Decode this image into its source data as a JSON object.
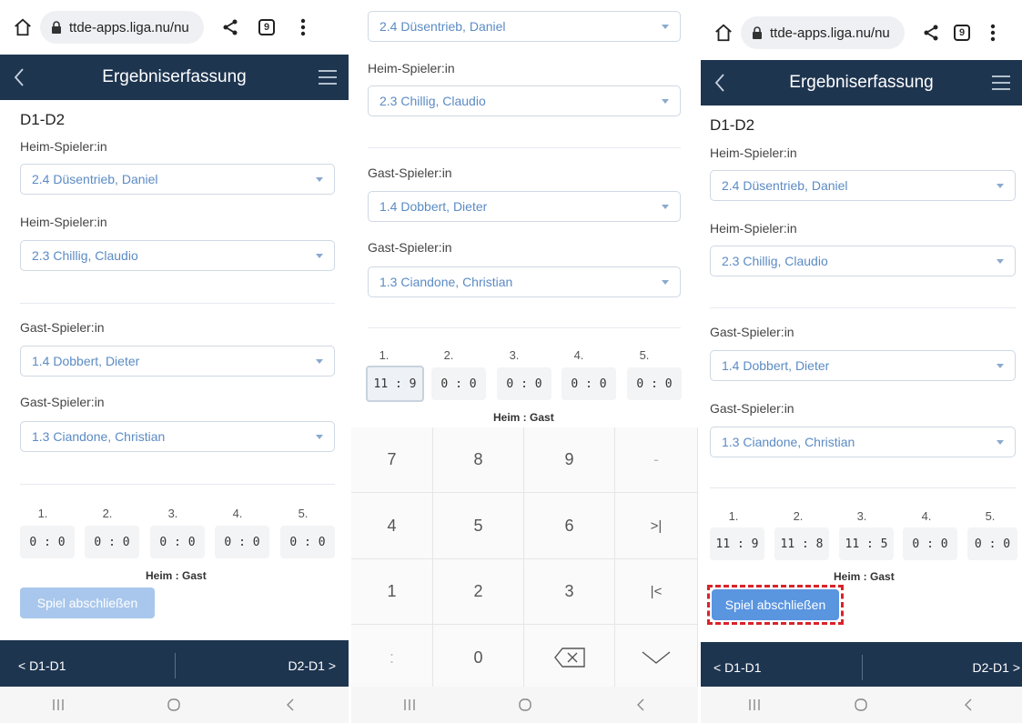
{
  "browser": {
    "url": "ttde-apps.liga.nu/nu",
    "tab_count": "9"
  },
  "app": {
    "title": "Ergebniserfassung"
  },
  "match": {
    "code": "D1-D2"
  },
  "labels": {
    "home_player": "Heim-Spieler:in",
    "guest_player": "Gast-Spieler:in",
    "home_guest": "Heim : Gast"
  },
  "players": {
    "home1": "2.4 Düsentrieb, Daniel",
    "home2": "2.3 Chillig, Claudio",
    "guest1": "1.4 Dobbert, Dieter",
    "guest2": "1.3 Ciandone, Christian"
  },
  "sets": {
    "headers": [
      "1.",
      "2.",
      "3.",
      "4.",
      "5."
    ],
    "scores_initial": [
      "0 : 0",
      "0 : 0",
      "0 : 0",
      "0 : 0",
      "0 : 0"
    ],
    "scores_editing": [
      "11 : 9",
      "0 : 0",
      "0 : 0",
      "0 : 0",
      "0 : 0"
    ],
    "scores_final": [
      "11 : 9",
      "11 : 8",
      "11 : 5",
      "0 : 0",
      "0 : 0"
    ]
  },
  "buttons": {
    "finish": "Spiel abschließen"
  },
  "footer": {
    "prev": "< D1-D1",
    "next": "D2-D1 >"
  },
  "keypad": {
    "keys": [
      "7",
      "8",
      "9",
      "-",
      "4",
      "5",
      "6",
      ">|",
      "1",
      "2",
      "3",
      "|<",
      ":",
      "0",
      "",
      ""
    ]
  },
  "colors": {
    "header_bg": "#1e3550",
    "link_blue": "#5b8bc4",
    "button_enabled": "#5a95e0",
    "button_disabled": "#a9c7ec",
    "highlight_red": "#d8232a"
  }
}
